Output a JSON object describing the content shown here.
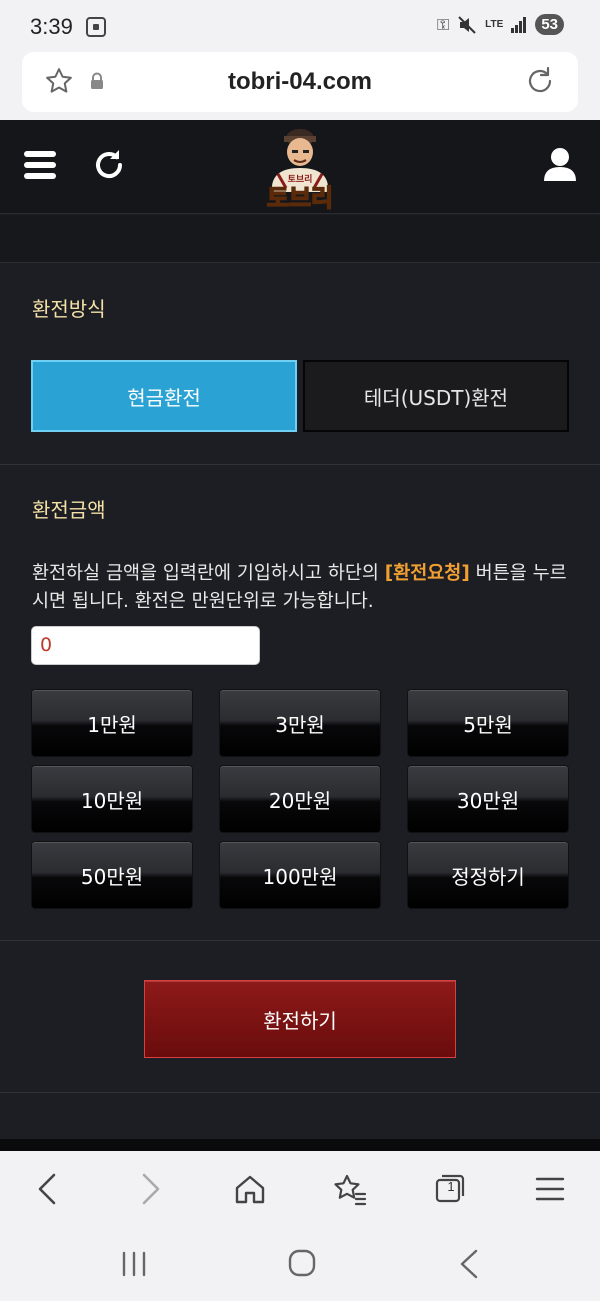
{
  "status_bar": {
    "time": "3:39",
    "battery": "53",
    "network": "LTE",
    "icons": [
      "screenshot-icon",
      "key-icon",
      "mute-icon",
      "lte-icon",
      "signal-icon",
      "battery-icon"
    ]
  },
  "browser": {
    "url": "tobri-04.com",
    "icons": [
      "star-icon",
      "lock-icon",
      "reload-icon"
    ],
    "toolbar": {
      "tab_count": "1",
      "icons": [
        "back-icon",
        "forward-icon",
        "home-icon",
        "bookmarks-icon",
        "tabs-icon",
        "menu-icon"
      ]
    }
  },
  "site": {
    "logo_text": "토브리",
    "header_icons": [
      "hamburger-menu-icon",
      "refresh-icon",
      "user-icon"
    ],
    "method_section": {
      "title": "환전방식",
      "options": [
        "현금환전",
        "테더(USDT)환전"
      ],
      "selected": "현금환전"
    },
    "amount_section": {
      "title": "환전금액",
      "description_pre": "환전하실 금액을 입력란에 기입하시고 하단의 ",
      "description_highlight": "[환전요청]",
      "description_post": " 버튼을 누르시면 됩니다. 환전은 만원단위로 가능합니다.",
      "input_value": "0",
      "amount_buttons": [
        "1만원",
        "3만원",
        "5만원",
        "10만원",
        "20만원",
        "30만원",
        "50만원",
        "100만원",
        "정정하기"
      ]
    },
    "submit_label": "환전하기"
  },
  "nav_bar": {
    "icons": [
      "recent-apps-icon",
      "home-circle-icon",
      "nav-back-icon"
    ]
  },
  "colors": {
    "site_bg": "#1d1e23",
    "section_title": "#f4e1a8",
    "selected_method": "#2aa3d4",
    "highlight": "#f0a033",
    "submit": "#7a1212"
  }
}
